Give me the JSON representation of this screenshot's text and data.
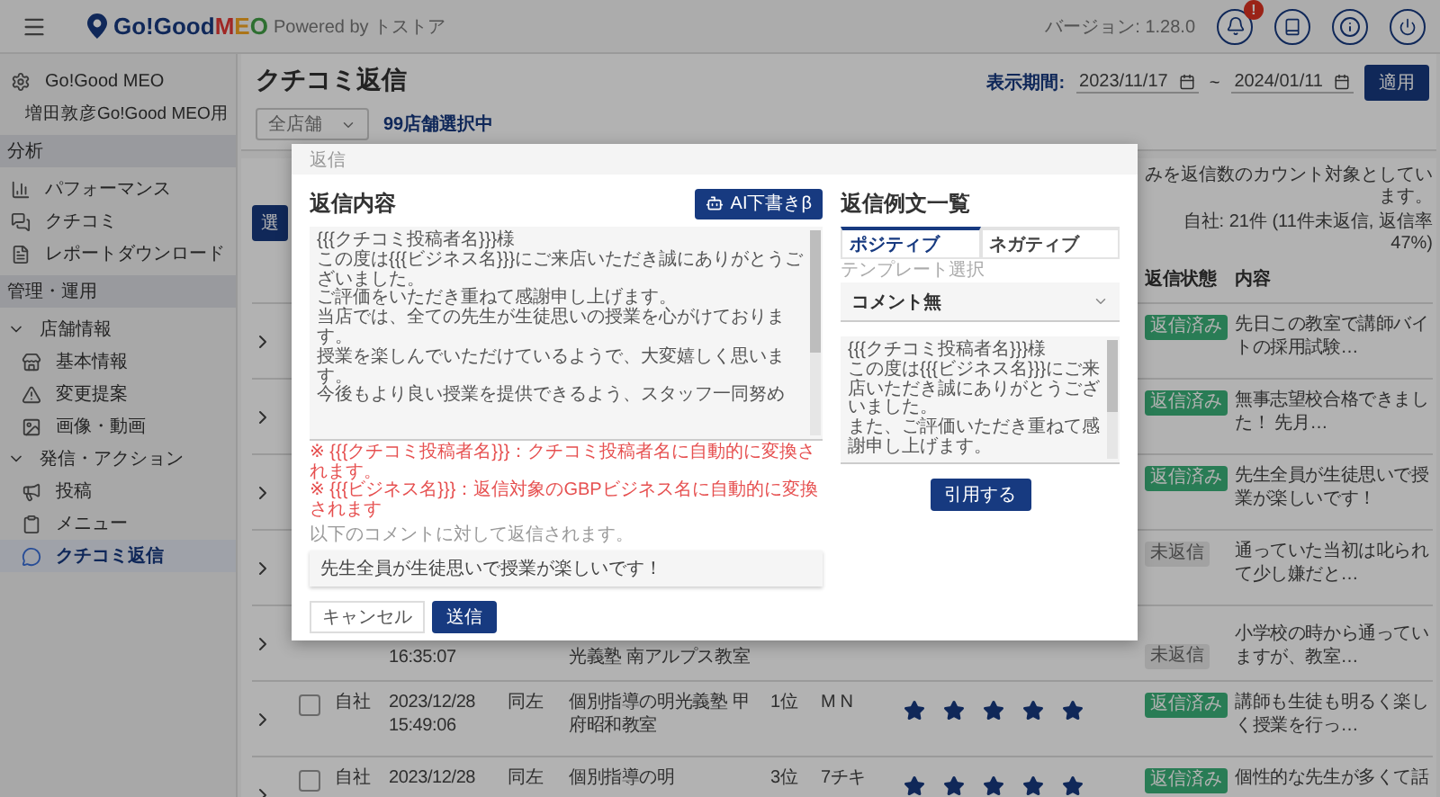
{
  "header": {
    "logo_name": "Go!Good",
    "logo_accent": "MEO",
    "logo_tagline": "Powered by トストア",
    "version": "バージョン: 1.28.0",
    "alert_badge": "!"
  },
  "sidebar": {
    "account": "Go!Good MEO",
    "store": "増田敦彦Go!Good MEO用",
    "sections": [
      {
        "title": "分析",
        "items": [
          {
            "label": "パフォーマンス",
            "selected": false
          },
          {
            "label": "クチコミ",
            "selected": false
          },
          {
            "label": "レポートダウンロード",
            "selected": false
          }
        ]
      },
      {
        "title": "管理・運用",
        "items": [
          {
            "label": "店舗情報",
            "expanded": true,
            "children": [
              {
                "label": "基本情報",
                "selected": false
              },
              {
                "label": "変更提案",
                "selected": false
              },
              {
                "label": "画像・動画",
                "selected": false
              }
            ]
          },
          {
            "label": "発信・アクション",
            "expanded": true,
            "children": [
              {
                "label": "投稿",
                "selected": false
              },
              {
                "label": "メニュー",
                "selected": false
              },
              {
                "label": "クチコミ返信",
                "selected": true
              }
            ]
          }
        ]
      }
    ]
  },
  "page": {
    "title": "クチコミ返信",
    "store_filter": "全店舗",
    "selection": "99店舗選択中",
    "period_label": "表示期間:",
    "date_from": "2023/11/17",
    "date_separator": "~",
    "date_to": "2024/01/11",
    "apply_button": "適用"
  },
  "reviews": {
    "select_button": "選",
    "note": "みを返信数のカウント対象としています。",
    "summary": "自社: 21件 (11件未返信, 返信率47%)",
    "columns": [
      "返信状態",
      "内容"
    ],
    "rows": [
      {
        "status": "返信済み",
        "replied": true,
        "content": "先日この教室で講師バイトの採用試験…"
      },
      {
        "status": "返信済み",
        "replied": true,
        "content": "無事志望校合格できました！ 先月…"
      },
      {
        "status": "返信済み",
        "replied": true,
        "content": "先生全員が生徒思いで授業が楽しいです！"
      },
      {
        "status": "未返信",
        "replied": false,
        "content": "通っていた当初は叱られて少し嫌だと…"
      },
      {
        "time": "16:35:07",
        "store": "光義塾 南アルプス教室",
        "status": "未返信",
        "replied": false,
        "content": "小学校の時から通っていますが、教室…"
      },
      {
        "checked": false,
        "owner": "自社",
        "date": "2023/12/28",
        "time": "15:49:06",
        "replier": "同左",
        "store": "個別指導の明光義塾 甲府昭和教室",
        "rank": "1位",
        "author": "M N",
        "stars": 5,
        "status": "返信済み",
        "replied": true,
        "content": "講師も生徒も明るく楽しく授業を行っ…"
      },
      {
        "checked": false,
        "owner": "自社",
        "date": "2023/12/28",
        "replier": "同左",
        "store": "個別指導の明",
        "rank": "3位",
        "author": "7チキ",
        "stars": 5,
        "status": "返信済み",
        "replied": true,
        "content": "個性的な先生が多くて話"
      }
    ]
  },
  "dialog": {
    "title": "返信",
    "reply": {
      "heading": "返信内容",
      "ai_button": "AI下書きβ",
      "lines": [
        "{{{クチコミ投稿者名}}}様",
        "この度は{{{ビジネス名}}}にご来店いただき誠にありがとうございました。",
        "ご評価をいただき重ねて感謝申し上げます。",
        "当店では、全ての先生が生徒思いの授業を心がけております。",
        "授業を楽しんでいただけているようで、大変嬉しく思います。",
        "今後もより良い授業を提供できるよう、スタッフ一同努め"
      ],
      "notes": [
        "※ {{{クチコミ投稿者名}}}：クチコミ投稿者名に自動的に変換されます。",
        "※ {{{ビジネス名}}}：返信対象のGBPビジネス名に自動的に変換されます"
      ],
      "target_label": "以下のコメントに対して返信されます。",
      "target_comment": "先生全員が生徒思いで授業が楽しいです！"
    },
    "examples": {
      "heading": "返信例文一覧",
      "tabs": [
        {
          "label": "ポジティブ",
          "selected": true
        },
        {
          "label": "ネガティブ",
          "selected": false
        }
      ],
      "template_label": "テンプレート選択",
      "template": "コメント無",
      "lines": [
        "{{{クチコミ投稿者名}}}様",
        "この度は{{{ビジネス名}}}にご来店いただき誠にありがとうございました。",
        "また、ご評価いただき重ねて感謝申し上げます。"
      ],
      "quote_button": "引用する"
    },
    "actions": [
      {
        "label": "キャンセル",
        "kind": "secondary"
      },
      {
        "label": "送信",
        "kind": "primary"
      }
    ]
  }
}
